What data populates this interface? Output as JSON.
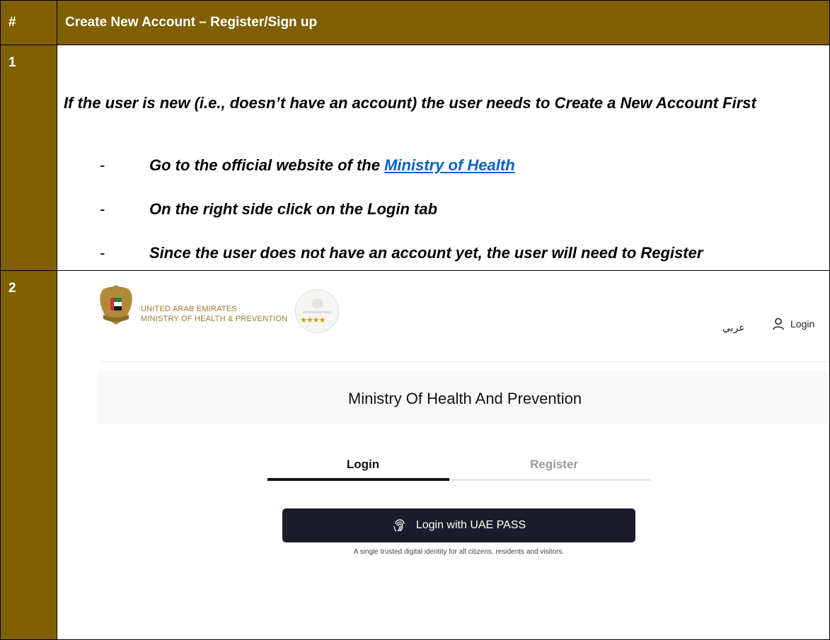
{
  "table": {
    "header": {
      "num": "#",
      "title": "Create New Account – Register/Sign up"
    },
    "row1": {
      "num": "1",
      "intro": "If the user is new (i.e., doesn’t have an account) the user needs to Create a New Account First",
      "steps": [
        {
          "dash": "-",
          "text_before": "Go to the official website of the ",
          "link": "Ministry of Health"
        },
        {
          "dash": "-",
          "text": "On the right side click on the Login tab"
        },
        {
          "dash": "-",
          "text": "Since the user does not have an account yet, the user will need to Register"
        }
      ]
    },
    "row2": {
      "num": "2",
      "screenshot": {
        "brand_line1": "UNITED ARAB EMIRATES",
        "brand_line2": "MINISTRY OF HEALTH & PREVENTION",
        "arabic_label": "عربي",
        "login_label": "Login",
        "banner_title": "Ministry Of Health And Prevention",
        "tabs": [
          "Login",
          "Register"
        ],
        "uae_pass_button": "Login with UAE PASS",
        "uae_pass_note": "A single trusted digital identity for all citizens, residents and visitors.",
        "seal_stars": "★★★★"
      }
    }
  },
  "colors": {
    "header_bg": "#7f6000",
    "link": "#0563c1",
    "button_bg": "#1b1c2b",
    "brand_gold": "#9a7b2c"
  },
  "icons": [
    "emirates-falcon-logo",
    "excellence-seal-icon",
    "user-icon",
    "fingerprint-icon"
  ]
}
